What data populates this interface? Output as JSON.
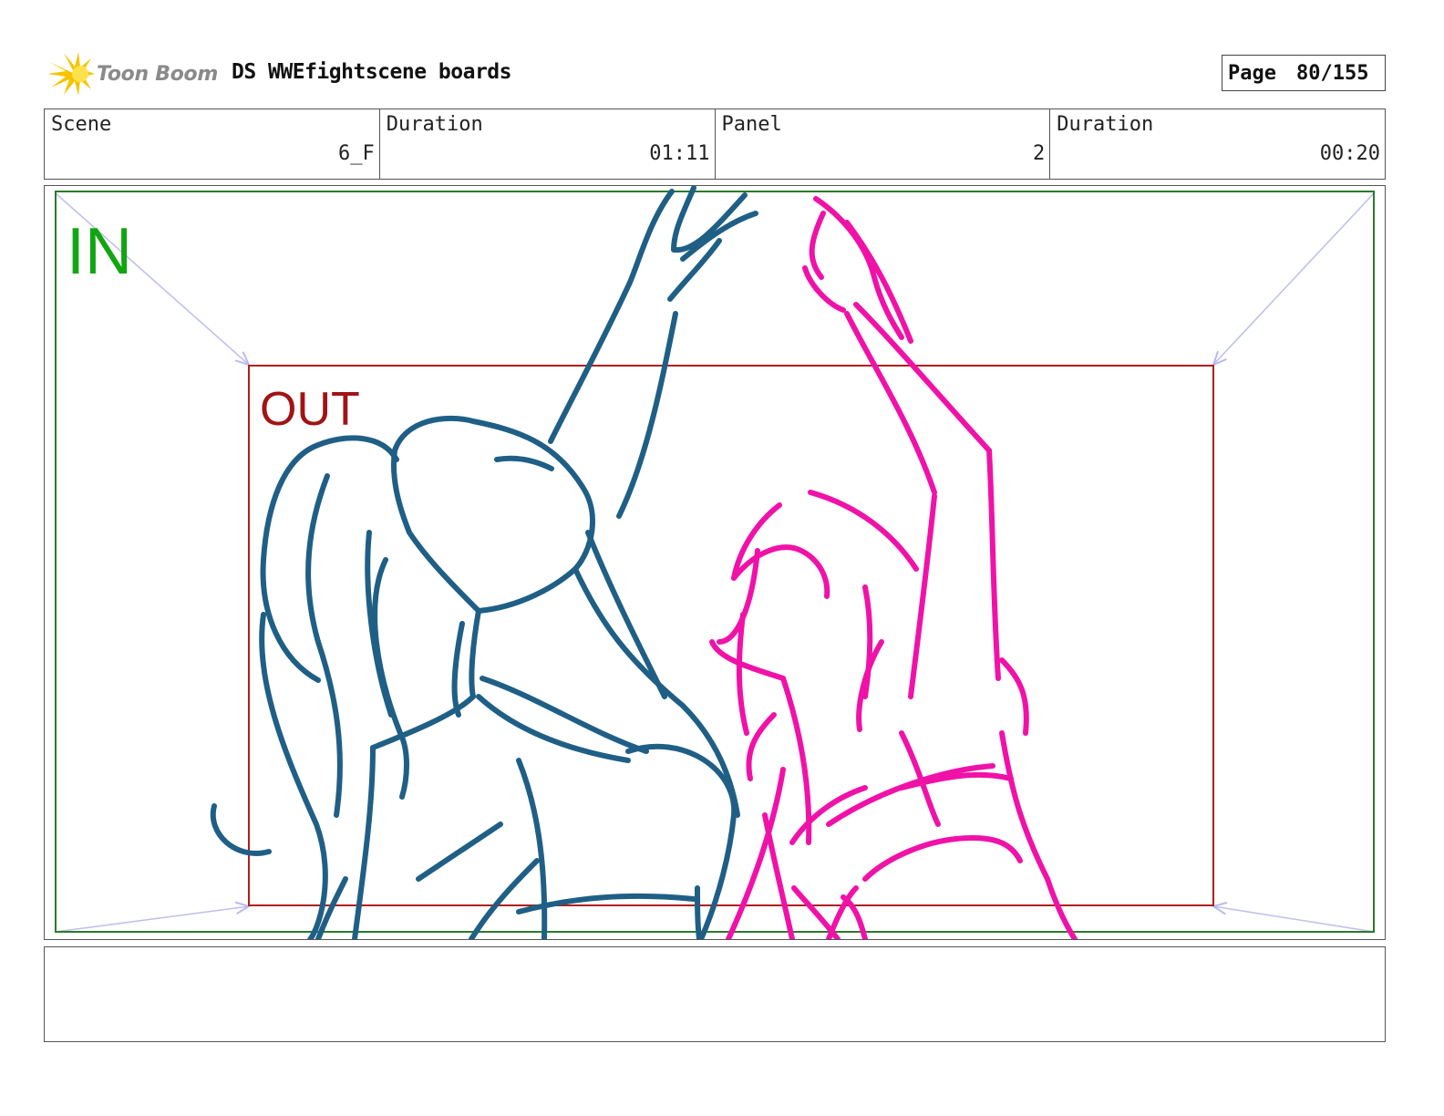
{
  "header": {
    "logo_text": "Toon Boom",
    "project_title": "DS WWEfightscene boards",
    "page_label": "Page",
    "page_number": "80/155"
  },
  "info": {
    "scene_label": "Scene",
    "scene_value": "6_F",
    "scene_duration_label": "Duration",
    "scene_duration_value": "01:11",
    "panel_label": "Panel",
    "panel_value": "2",
    "panel_duration_label": "Duration",
    "panel_duration_value": "00:20"
  },
  "frame": {
    "in_label": "IN",
    "out_label": "OUT",
    "in_color": "#12a512",
    "out_color": "#a01414",
    "sketch_blue": "#1f5f86",
    "sketch_pink": "#f012a8"
  },
  "caption": ""
}
